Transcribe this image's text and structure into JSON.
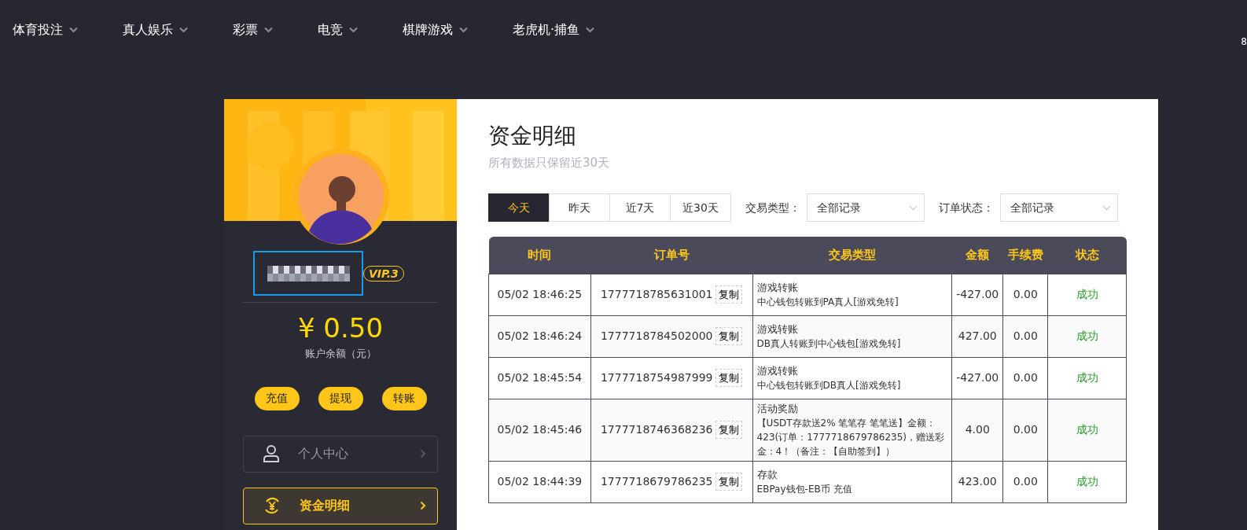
{
  "nav": [
    {
      "label": "体育投注"
    },
    {
      "label": "真人娱乐"
    },
    {
      "label": "彩票"
    },
    {
      "label": "电竞"
    },
    {
      "label": "棋牌游戏"
    },
    {
      "label": "老虎机·捕鱼"
    }
  ],
  "edge_text": "8",
  "profile": {
    "vip": "VIP.3",
    "balance": "¥ 0.50",
    "balance_label": "账户余额（元）",
    "actions": [
      "充值",
      "提现",
      "转账"
    ],
    "menu": [
      {
        "label": "个人中心",
        "kind": "person",
        "selected": false
      },
      {
        "label": "资金明细",
        "kind": "yen",
        "selected": true
      }
    ]
  },
  "main": {
    "title": "资金明细",
    "subtitle": "所有数据只保留近30天",
    "ranges": [
      {
        "label": "今天",
        "selected": true
      },
      {
        "label": "昨天",
        "selected": false
      },
      {
        "label": "近7天",
        "selected": false
      },
      {
        "label": "近30天",
        "selected": false
      }
    ],
    "filters": [
      {
        "label": "交易类型：",
        "value": "全部记录"
      },
      {
        "label": "订单状态：",
        "value": "全部记录"
      }
    ],
    "table": {
      "columns": [
        "时间",
        "订单号",
        "交易类型",
        "金额",
        "手续费",
        "状态"
      ],
      "rows": [
        {
          "time": "05/02 18:46:25",
          "order": "1777718785631001",
          "copy": "复制",
          "type": "游戏转账",
          "detail": "中心钱包转账到PA真人[游戏免转]",
          "amount": "-427.00",
          "fee": "0.00",
          "status": "成功"
        },
        {
          "time": "05/02 18:46:24",
          "order": "1777718784502000",
          "copy": "复制",
          "type": "游戏转账",
          "detail": "DB真人转账到中心钱包[游戏免转]",
          "amount": "427.00",
          "fee": "0.00",
          "status": "成功"
        },
        {
          "time": "05/02 18:45:54",
          "order": "1777718754987999",
          "copy": "复制",
          "type": "游戏转账",
          "detail": "中心钱包转账到DB真人[游戏免转]",
          "amount": "-427.00",
          "fee": "0.00",
          "status": "成功"
        },
        {
          "time": "05/02 18:45:46",
          "order": "1777718746368236",
          "copy": "复制",
          "type": "活动奖励",
          "detail": "【USDT存款送2% 笔笔存 笔笔送】金额：423(订单：1777718679786235)，赠送彩金：4！（备注：【自助签到】）",
          "amount": "4.00",
          "fee": "0.00",
          "status": "成功"
        },
        {
          "time": "05/02 18:44:39",
          "order": "1777718679786235",
          "copy": "复制",
          "type": "存款",
          "detail": "EBPay钱包-EB币 充值",
          "amount": "423.00",
          "fee": "0.00",
          "status": "成功"
        }
      ]
    }
  }
}
